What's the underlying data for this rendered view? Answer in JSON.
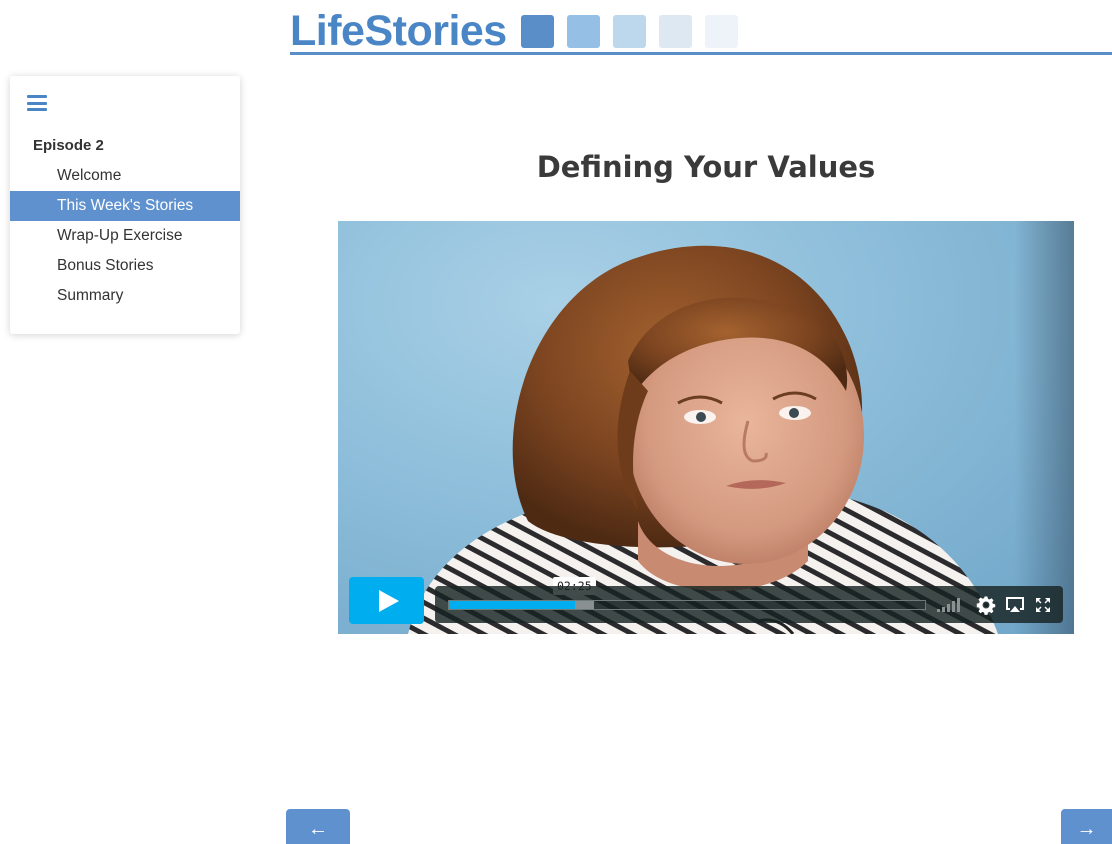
{
  "header": {
    "logo_text": "LifeStories",
    "logo_square_colors": [
      "#5a8ec9",
      "#95bfe4",
      "#bdd8ec",
      "#dde8f3",
      "#eef3fa"
    ],
    "accent_color": "#4a86c6"
  },
  "sidebar": {
    "menu_icon": "hamburger-menu-icon",
    "episode_title": "Episode 2",
    "items": [
      {
        "label": "Welcome",
        "active": false
      },
      {
        "label": "This Week's Stories",
        "active": true
      },
      {
        "label": "Wrap-Up Exercise",
        "active": false
      },
      {
        "label": "Bonus Stories",
        "active": false
      },
      {
        "label": "Summary",
        "active": false
      }
    ],
    "active_color": "#5f91cf"
  },
  "main": {
    "title": "Defining Your Values"
  },
  "video_player": {
    "state": "paused",
    "hover_time": "02:25",
    "played_fraction": 0.265,
    "buffered_fraction": 0.305,
    "accent_color": "#00adef",
    "icons": [
      "play-icon",
      "volume-icon",
      "settings-gear-icon",
      "airplay-icon",
      "fullscreen-icon"
    ]
  },
  "navigation": {
    "prev_label": "←",
    "next_label": "→"
  }
}
